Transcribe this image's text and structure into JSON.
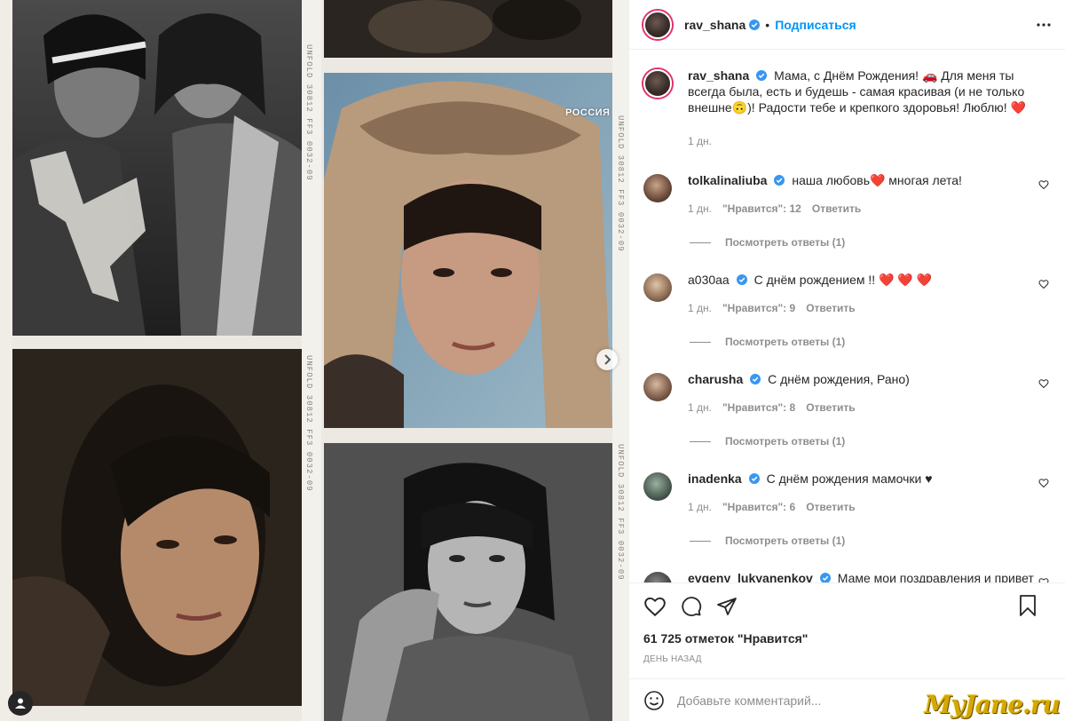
{
  "post": {
    "author": "rav_shana",
    "follow_label": "Подписаться",
    "dot": "•",
    "caption": "Мама, с Днём Рождения! 🚗 Для меня ты всегда была, есть и будешь - самая красивая (и не только внешне🙃)! Радости тебе и крепкого здоровья! Люблю! ❤️",
    "caption_age": "1 дн.",
    "likes": "61 725 отметок \"Нравится\"",
    "posted": "ДЕНЬ НАЗАД",
    "add_comment_placeholder": "Добавьте комментарий..."
  },
  "media": {
    "tv_logo": "РОССИЯ",
    "film_text_1": "UNFOLD 30812 FF3 0032-09",
    "film_text_2": "UNFOLD 30812 FF3 0032-09",
    "film_text_3": "UNFOLD 30812 FF3 0032-09",
    "film_text_4": "UNFOLD 30812 FF3 0032-09"
  },
  "comments": [
    {
      "user": "tolkalinaliuba",
      "verified": true,
      "text": "наша любовь❤️ многая лета!",
      "age": "1 дн.",
      "likes": "\"Нравится\": 12",
      "reply": "Ответить",
      "replies": "Посмотреть ответы (1)"
    },
    {
      "user": "a030aa",
      "verified": true,
      "text": "С днём рождением !! ❤️ ❤️ ❤️",
      "age": "1 дн.",
      "likes": "\"Нравится\": 9",
      "reply": "Ответить",
      "replies": "Посмотреть ответы (1)"
    },
    {
      "user": "charusha",
      "verified": true,
      "text": "С днём рождения, Рано)",
      "age": "1 дн.",
      "likes": "\"Нравится\": 8",
      "reply": "Ответить",
      "replies": "Посмотреть ответы (1)"
    },
    {
      "user": "inadenka",
      "verified": true,
      "text": "С днём рождения мамочки ♥",
      "age": "1 дн.",
      "likes": "\"Нравится\": 6",
      "reply": "Ответить",
      "replies": "Посмотреть ответы (1)"
    },
    {
      "user": "evgeny_lukyanenkov",
      "verified": true,
      "text": "Маме мои поздравления и привет !!!!"
    }
  ],
  "watermark": "MyJane.ru",
  "colors": {
    "accent": "#0095f6",
    "heart": "#ed4956",
    "muted": "#8e8e8e"
  },
  "icons": [
    "more-icon",
    "verified-badge-icon",
    "heart-icon",
    "comment-icon",
    "share-icon",
    "bookmark-icon",
    "emoji-icon",
    "chevron-right-icon",
    "user-tag-icon"
  ]
}
